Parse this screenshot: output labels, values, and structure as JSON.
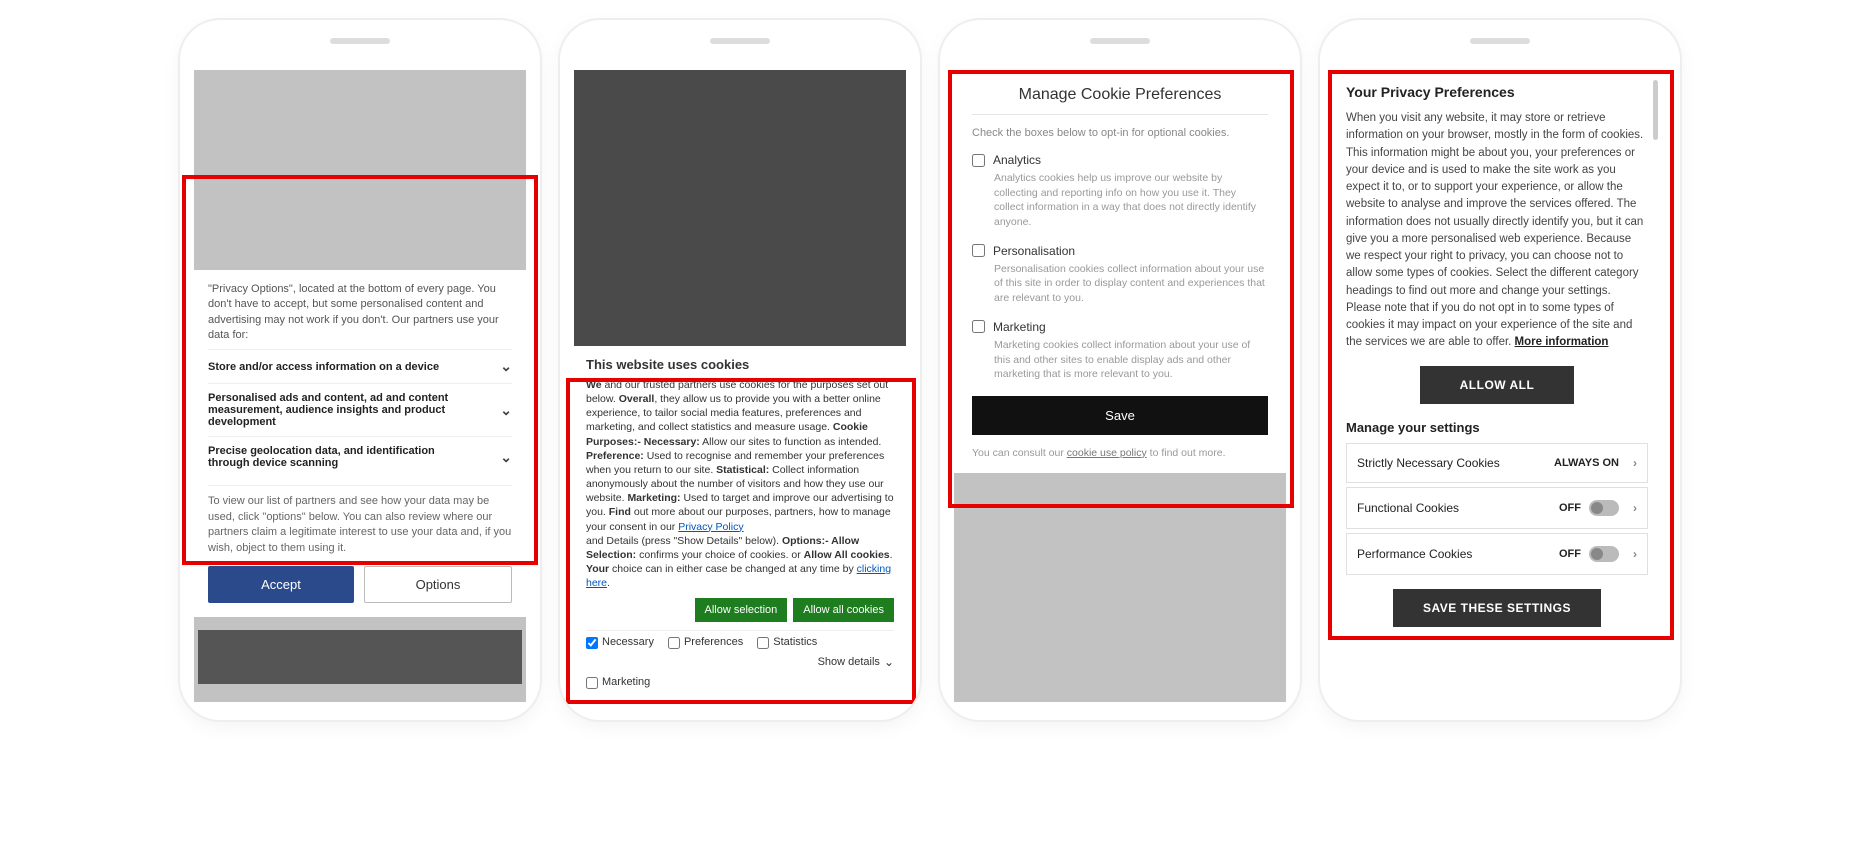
{
  "phone1": {
    "intro": "\"Privacy Options\", located at the bottom of every page. You don't have to accept, but some personalised content and advertising may not work if you don't. Our partners use your data for:",
    "rows": [
      "Store and/or access information on a device",
      "Personalised ads and content, ad and content measurement, audience insights and product development",
      "Precise geolocation data, and identification through device scanning"
    ],
    "foot": "To view our list of partners and see how your data may be used, click \"options\" below. You can also review where our partners claim a legitimate interest to use your data and, if you wish, object to them using it.",
    "accept": "Accept",
    "options": "Options"
  },
  "phone2": {
    "title": "This website uses cookies",
    "b_we": "We",
    "t1": " and our trusted partners use cookies for the purposes set out below. ",
    "b_overall": "Overall",
    "t2": ", they allow us to provide you with a better online experience, to tailor social media features, preferences and marketing, and collect statistics and measure usage. ",
    "b_cookie_purpose": "Cookie Purposes:- Necessary:",
    "t3": " Allow our sites to function as intended. ",
    "b_pref": "Preference:",
    "t4": " Used to recognise and remember your preferences when you return to our site. ",
    "b_stat": "Statistical:",
    "t5": " Collect information anonymously about the number of visitors and how they use our website. ",
    "b_mkt": "Marketing:",
    "t6": " Used to target and improve our advertising to you. ",
    "b_find": "Find",
    "t7": " out more about our purposes, partners, how to manage your consent in our ",
    "link_privacy": "Privacy Policy",
    "t8": " and Details (press \"Show Details\" below). ",
    "b_opt": "Options:- Allow Selection:",
    "t9": " confirms your choice of cookies. or ",
    "b_allowall": "Allow All cookies",
    "t10": ". ",
    "b_your": "Your",
    "t11": " choice can in either case be changed at any time by ",
    "link_click": "clicking here",
    "t12": ".",
    "btn_sel": "Allow selection",
    "btn_all": "Allow all cookies",
    "chk_nec": "Necessary",
    "chk_pref": "Preferences",
    "chk_stat": "Statistics",
    "chk_mkt": "Marketing",
    "show_details": "Show details"
  },
  "phone3": {
    "title": "Manage Cookie Preferences",
    "sub": "Check the boxes below to opt-in for optional cookies.",
    "items": [
      {
        "label": "Analytics",
        "desc": "Analytics cookies help us improve our website by collecting and reporting info on how you use it. They collect information in a way that does not directly identify anyone."
      },
      {
        "label": "Personalisation",
        "desc": "Personalisation cookies collect information about your use of this site in order to display content and experiences that are relevant to you."
      },
      {
        "label": "Marketing",
        "desc": "Marketing cookies collect information about your use of this and other sites to enable display ads and other marketing that is more relevant to you."
      }
    ],
    "save": "Save",
    "foot_pre": "You can consult our ",
    "foot_link": "cookie use policy",
    "foot_post": " to find out more."
  },
  "phone4": {
    "title": "Your Privacy Preferences",
    "body": "When you visit any website, it may store or retrieve information on your browser, mostly in the form of cookies. This information might be about you, your preferences or your device and is used to make the site work as you expect it to, or to support your experience, or allow the website to analyse and improve the services offered. The information does not usually directly identify you, but it can give you a more personalised web experience. Because we respect your right to privacy, you can choose not to allow some types of cookies. Select the different category headings to find out more and change your settings. Please note that if you do not opt in to some types of cookies it may impact on your experience of the site and the services we are able to offer.  ",
    "more_info": "More information",
    "allow_all": "ALLOW ALL",
    "manage": "Manage your settings",
    "rows": [
      {
        "label": "Strictly Necessary Cookies",
        "state": "ALWAYS ON",
        "toggle": false
      },
      {
        "label": "Functional Cookies",
        "state": "OFF",
        "toggle": true
      },
      {
        "label": "Performance Cookies",
        "state": "OFF",
        "toggle": true
      }
    ],
    "save": "SAVE THESE SETTINGS"
  }
}
